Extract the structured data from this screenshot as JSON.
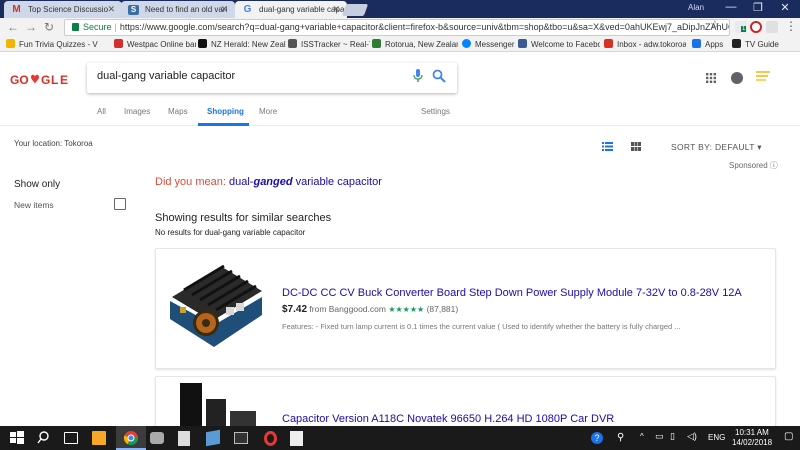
{
  "browser": {
    "tabs": [
      {
        "title": "Top Science Discussio",
        "active": false,
        "favicon": "gmail-icon"
      },
      {
        "title": "Need to find an old vari",
        "active": false,
        "favicon": "forum-icon"
      },
      {
        "title": "dual-gang variable capa",
        "active": true,
        "favicon": "google-icon"
      }
    ],
    "user_chip": "Alan",
    "window_controls": {
      "minimize": "—",
      "maximize": "❐",
      "close": "✕"
    },
    "nav": {
      "back": "←",
      "forward": "→",
      "reload": "↻"
    },
    "secure_label": "Secure",
    "url": "https://www.google.com/search?q=dual-gang+variable+capacitor&client=firefox-b&source=univ&tbm=shop&tbo=u&sa=X&ved=0ahUKEwj7_aDipJnZAhUOE...",
    "star": "☆",
    "extension_badge": "1",
    "menu": "⋮"
  },
  "bookmarks": [
    {
      "label": "Fun Trivia Quizzes - V",
      "color": "#f4b400"
    },
    {
      "label": "Westpac Online bank",
      "color": "#d32f2f"
    },
    {
      "label": "NZ Herald: New Zeala",
      "color": "#111111"
    },
    {
      "label": "ISSTracker ~ Real-Tim",
      "color": "#555555"
    },
    {
      "label": "Rotorua, New Zealand",
      "color": "#2e7d32"
    },
    {
      "label": "Messenger",
      "color": "#0084ff"
    },
    {
      "label": "Welcome to Facebook",
      "color": "#3b5998"
    },
    {
      "label": "Inbox - adw.tokoroa",
      "color": "#d93025"
    },
    {
      "label": "Apps",
      "color": "#1a73e8"
    },
    {
      "label": "TV Guide",
      "color": "#222222"
    }
  ],
  "google": {
    "logo_text": "GO❤GLE",
    "query": "dual-gang variable capacitor",
    "tabs": [
      "All",
      "Images",
      "Maps",
      "Shopping",
      "More"
    ],
    "settings_label": "Settings",
    "location": "Your location: Tokoroa",
    "sort_label": "SORT BY: DEFAULT",
    "sponsored": "Sponsored ⓘ",
    "show_only": "Show only",
    "new_items": "New items",
    "did_you_mean_prefix": "Did you mean:",
    "did_you_mean_pre": "dual-",
    "did_you_mean_bold": "ganged",
    "did_you_mean_post": "variable capacitor",
    "showing_results": "Showing results for similar searches",
    "no_results": "No results for dual-gang variable capacitor"
  },
  "results": [
    {
      "title": "DC-DC CC CV Buck Converter Board Step Down Power Supply Module 7-32V to 0.8-28V 12A",
      "price": "$7.42",
      "seller": "from Banggood.com",
      "rating": 4.5,
      "stars": "★★★★★",
      "reviews": "(87,881)",
      "features": "Features: - Fixed turn lamp current is 0.1 times the current value ( Used to identify whether the battery is fully charged ..."
    },
    {
      "title": "Capacitor Version A118C Novatek 96650 H.264 HD 1080P Car DVR"
    }
  ],
  "taskbar": {
    "time": "10:31 AM",
    "date": "14/02/2018",
    "lang": "ENG"
  }
}
